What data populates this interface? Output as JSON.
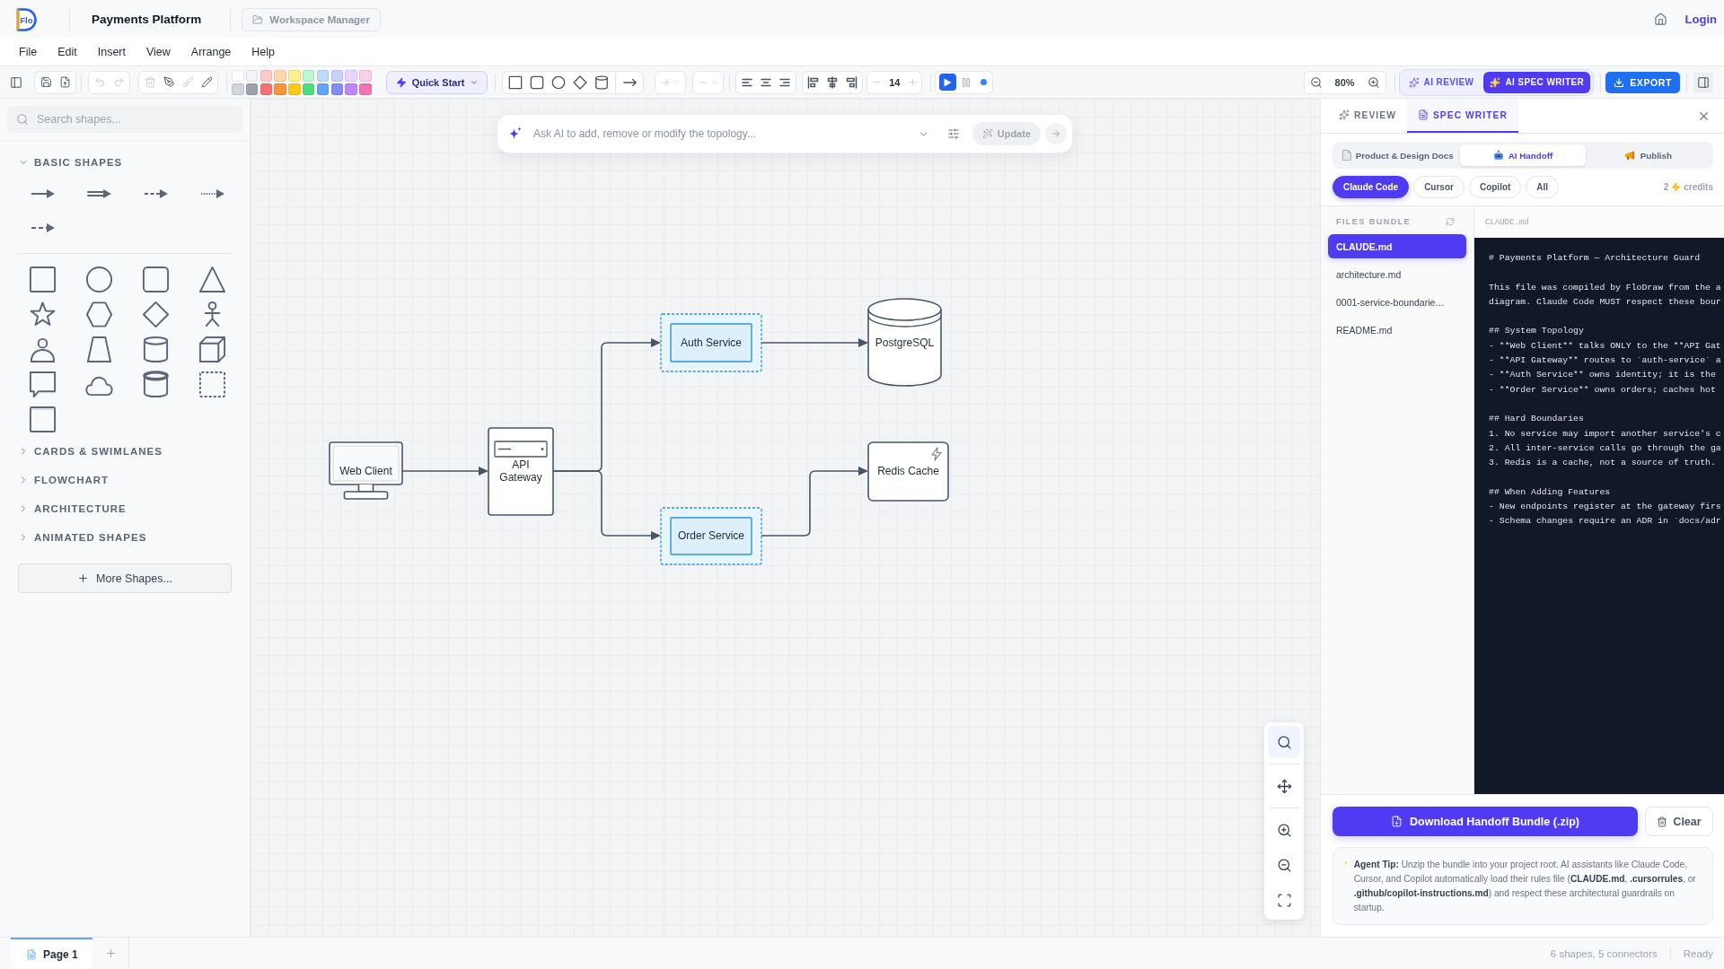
{
  "header": {
    "logo_text": "Flo",
    "title": "Payments Platform",
    "workspace_button": "Workspace Manager",
    "login_link": "Login"
  },
  "menu": [
    "File",
    "Edit",
    "Insert",
    "View",
    "Arrange",
    "Help"
  ],
  "toolbar": {
    "history": [
      {
        "kind": "undo",
        "disabled": true
      },
      {
        "kind": "redo",
        "disabled": true
      }
    ],
    "edit_tools": [
      {
        "kind": "delete",
        "disabled": true
      },
      {
        "kind": "pen",
        "disabled": false
      },
      {
        "kind": "brush",
        "disabled": true
      },
      {
        "kind": "pencil",
        "disabled": false
      }
    ],
    "palette": [
      {
        "color": "#ffffff"
      },
      {
        "color": "#f3f4f6"
      },
      {
        "color": "#fecaca"
      },
      {
        "color": "#fed7aa"
      },
      {
        "color": "#fef08a"
      },
      {
        "color": "#bbf7d0"
      },
      {
        "color": "#bfdbfe"
      },
      {
        "color": "#c7d2fe"
      },
      {
        "color": "#e9d5ff"
      },
      {
        "color": "#fbcfe8"
      },
      {
        "color": "#d1d5db"
      },
      {
        "color": "#9ca3af"
      },
      {
        "color": "#f87171"
      },
      {
        "color": "#fb923c"
      },
      {
        "color": "#facc15"
      },
      {
        "color": "#4ade80"
      },
      {
        "color": "#60a5fa"
      },
      {
        "color": "#818cf8"
      },
      {
        "color": "#c084fc"
      },
      {
        "color": "#f472b6"
      }
    ],
    "quick_start": "Quick Start",
    "line_controls": [
      {
        "kind": "arrow",
        "disabled": true
      },
      {
        "kind": "line",
        "disabled": true
      }
    ],
    "font_size": "14",
    "playing": true,
    "zoom": "80%",
    "ai_modes": [
      {
        "label": "AI REVIEW",
        "selected": false
      },
      {
        "label": "AI SPEC WRITER",
        "selected": true
      }
    ],
    "export_button": "EXPORT"
  },
  "sidebar": {
    "search": {
      "placeholder": "Search shapes..."
    },
    "sections": [
      {
        "title": "BASIC SHAPES",
        "expanded": true
      },
      {
        "title": "CARDS & SWIMLANES",
        "expanded": false
      },
      {
        "title": "FLOWCHART",
        "expanded": false
      },
      {
        "title": "ARCHITECTURE",
        "expanded": false
      },
      {
        "title": "ANIMATED SHAPES",
        "expanded": false
      }
    ],
    "more_button": "More Shapes..."
  },
  "canvas": {
    "prompt": {
      "placeholder": "Ask AI to add, remove or modify the topology...",
      "update_button": {
        "label": "Update",
        "disabled": true
      }
    },
    "nodes": [
      {
        "kind": "client",
        "label": "Web Client",
        "selected": false
      },
      {
        "kind": "gateway",
        "label": "API Gateway",
        "selected": false
      },
      {
        "kind": "service",
        "label": "Auth Service",
        "selected": true
      },
      {
        "kind": "database",
        "label": "PostgreSQL",
        "selected": false
      },
      {
        "kind": "service",
        "label": "Order Service",
        "selected": true
      },
      {
        "kind": "cache",
        "label": "Redis Cache",
        "selected": false
      }
    ],
    "tools": [
      {
        "kind": "search",
        "selected": true
      },
      {
        "kind": "pan",
        "selected": false
      },
      {
        "kind": "zoom_in",
        "selected": false
      },
      {
        "kind": "zoom_out",
        "selected": false
      },
      {
        "kind": "fit",
        "selected": false
      }
    ]
  },
  "right_panel": {
    "tabs": [
      {
        "label": "REVIEW",
        "kind": "review",
        "selected": false
      },
      {
        "label": "SPEC WRITER",
        "kind": "spec",
        "selected": true
      }
    ],
    "sections": [
      {
        "label": "Product & Design Docs",
        "kind": "docs",
        "selected": false
      },
      {
        "label": "AI Handoff",
        "kind": "handoff",
        "selected": true
      },
      {
        "label": "Publish",
        "kind": "publish",
        "selected": false
      }
    ],
    "targets": [
      {
        "label": "Claude Code",
        "selected": true
      },
      {
        "label": "Cursor",
        "selected": false
      },
      {
        "label": "Copilot",
        "selected": false
      },
      {
        "label": "All",
        "selected": false
      }
    ],
    "credits": {
      "count": "2",
      "label": "credits"
    },
    "files_title": "FILES BUNDLE",
    "files": [
      {
        "name": "CLAUDE.md",
        "selected": true
      },
      {
        "name": "architecture.md",
        "selected": false
      },
      {
        "name": "0001-service-boundarie…",
        "selected": false
      },
      {
        "name": "README.md",
        "selected": false
      }
    ],
    "viewer": {
      "file_name": "CLAUDE.md",
      "blocks": [
        [
          "# Payments Platform — Architecture Guard"
        ],
        [
          "This file was compiled by FloDraw from the a",
          "diagram. Claude Code MUST respect these bour"
        ],
        [
          "## System Topology",
          "- **Web Client** talks ONLY to the **API Gat",
          "- **API Gateway** routes to `auth-service` a",
          "- **Auth Service** owns identity; it is the",
          "- **Order Service** owns orders; caches hot"
        ],
        [
          "## Hard Boundaries",
          "1. No service may import another service's c",
          "2. All inter-service calls go through the ga",
          "3. Redis is a cache, not a source of truth."
        ],
        [
          "## When Adding Features",
          "- New endpoints register at the gateway firs",
          "- Schema changes require an ADR in `docs/adr"
        ]
      ]
    },
    "download_button": "Download Handoff Bundle (.zip)",
    "clear_button": "Clear",
    "tip": "**Agent Tip:** Unzip the bundle into your project root. AI assistants like Claude Code, Cursor, and Copilot automatically load their rules file (**CLAUDE.md**, **.cursorrules**, or **.github/copilot-instructions.md**) and respect these architectural guardrails on startup."
  },
  "status_bar": {
    "pages": [
      {
        "label": "Page 1",
        "selected": true
      }
    ],
    "summary": "6 shapes, 5 connectors",
    "status": "Ready"
  }
}
